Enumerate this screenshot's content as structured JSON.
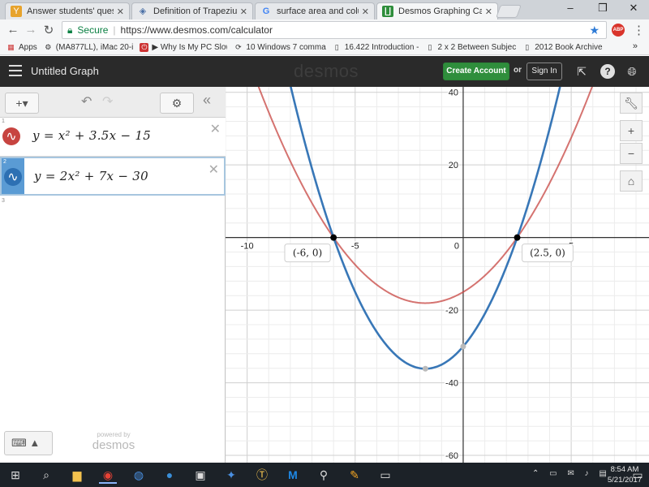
{
  "browser": {
    "tabs": [
      {
        "label": "Answer students' questi",
        "icon": "Y",
        "color": "#e7a32c"
      },
      {
        "label": "Definition of Trapezium",
        "icon": "◈",
        "color": "#4a6fa5"
      },
      {
        "label": "surface area and colume",
        "icon": "G",
        "color": "#4285f4"
      },
      {
        "label": "Desmos Graphing Calcul",
        "icon": "∐",
        "color": "#2f8e3c"
      }
    ],
    "window_controls": {
      "minimize": "–",
      "maximize": "❒",
      "close": "✕"
    },
    "address": {
      "secure_label": "Secure",
      "url": "https://www.desmos.com/calculator"
    },
    "abp_label": "ABP",
    "bookmarks": [
      {
        "label": "Apps"
      },
      {
        "label": "(MA877LL), iMac 20-i"
      },
      {
        "label": "▶ Why Is My PC Slow"
      },
      {
        "label": "10 Windows 7 comma"
      },
      {
        "label": "16.422 Introduction -"
      },
      {
        "label": "2 x 2 Between Subjec"
      },
      {
        "label": "2012 Book Archive"
      }
    ],
    "bookmarks_more": "»"
  },
  "desmos": {
    "graph_title": "Untitled Graph",
    "logo": "desmos",
    "create_account": "Create Account",
    "or_text": "or",
    "sign_in": "Sign In",
    "expressions": [
      {
        "num": "1",
        "latex": "y = x² + 3.5x − 15",
        "color": "#c74440"
      },
      {
        "num": "2",
        "latex": "y = 2x² + 7x − 30",
        "color": "#2d70b3"
      }
    ],
    "empty_row_num": "3",
    "powered_by": "powered by",
    "powered_logo": "desmos"
  },
  "chart_data": {
    "type": "line",
    "xlim": [
      -11,
      8.6
    ],
    "ylim": [
      -62,
      41.5
    ],
    "x_ticks": [
      -10,
      -5,
      0,
      5
    ],
    "y_ticks": [
      40,
      20,
      -20,
      -40,
      -60
    ],
    "grid": true,
    "series": [
      {
        "latex": "y = x^2 + 3.5x - 15",
        "a": 1,
        "b": 3.5,
        "c": -15,
        "color": "#c74440"
      },
      {
        "latex": "y = 2x^2 + 7x - 30",
        "a": 2,
        "b": 7,
        "c": -30,
        "color": "#2d70b3"
      }
    ],
    "points": [
      {
        "x": -6,
        "y": 0,
        "label": "(-6, 0)",
        "style": "filled"
      },
      {
        "x": 2.5,
        "y": 0,
        "label": "(2.5, 0)",
        "style": "filled"
      },
      {
        "x": -1.75,
        "y": -36.125,
        "label": "",
        "style": "gray"
      },
      {
        "x": 0,
        "y": -30,
        "label": "",
        "style": "gray"
      }
    ]
  },
  "taskbar": {
    "time": "8:54 AM",
    "date": "5/21/2017"
  }
}
